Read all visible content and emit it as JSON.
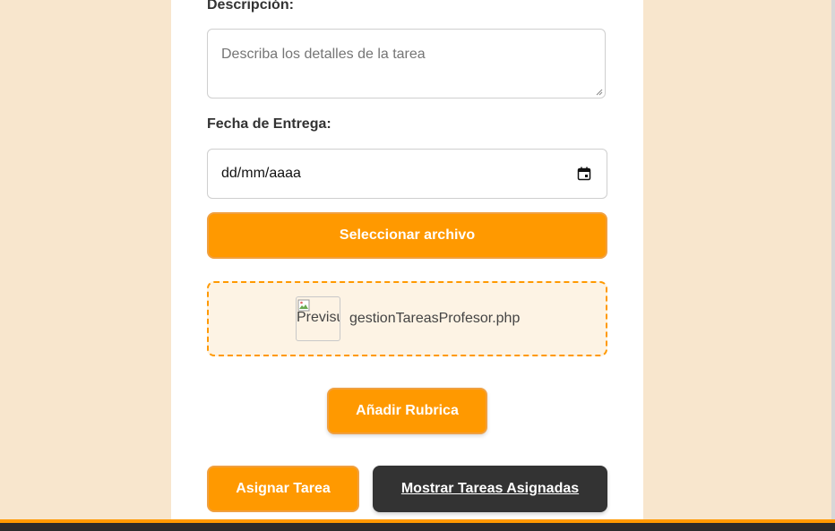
{
  "form": {
    "descripcion_label": "Descripción:",
    "descripcion_placeholder": "Describa los detalles de la tarea",
    "fecha_label": "Fecha de Entrega:",
    "fecha_value": "dd/mm/aaaa",
    "seleccionar_label": "Seleccionar archivo",
    "preview_alt": "Previsualización",
    "file_name": "gestionTareasProfesor.php",
    "rubrica_label": "Añadir Rubrica",
    "asignar_label": "Asignar Tarea",
    "mostrar_label": "Mostrar Tareas Asignadas"
  },
  "icons": {
    "calendar": "calendar-icon",
    "broken_image": "broken-image-icon",
    "resize": "resize-handle-icon"
  },
  "colors": {
    "accent": "#ff9900",
    "background": "#f8e6cd",
    "dark_button": "#333333",
    "footer": "#2b2b2b"
  }
}
